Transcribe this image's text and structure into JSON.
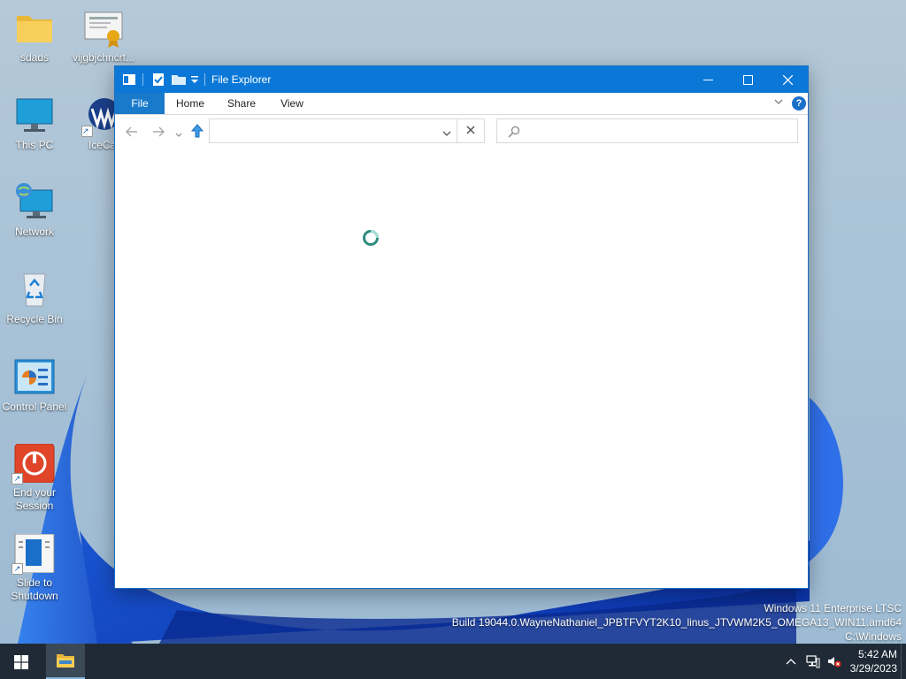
{
  "desktop": {
    "icons": [
      {
        "label": "sdads"
      },
      {
        "label": "vijgbjchncrt..."
      },
      {
        "label": "This PC"
      },
      {
        "label": "IceCa"
      },
      {
        "label": "Network"
      },
      {
        "label": "Recycle Bin"
      },
      {
        "label": "Control Panel"
      },
      {
        "label": "End your Session"
      },
      {
        "label": "Slide to Shutdown"
      }
    ],
    "watermark": {
      "line1": "Windows 11 Enterprise LTSC",
      "line2": "Build 19044.0.WayneNathaniel_JPBTFVYT2K10_linus_JTVWM2K5_OMEGA13_WIN11.amd64",
      "line3": "C:\\Windows"
    }
  },
  "window": {
    "title": "File Explorer",
    "ribbon": {
      "tabs": [
        {
          "label": "File"
        },
        {
          "label": "Home"
        },
        {
          "label": "Share"
        },
        {
          "label": "View"
        }
      ],
      "help": "?"
    },
    "address": {
      "value": "",
      "placeholder": ""
    },
    "search": {
      "value": "",
      "placeholder": ""
    }
  },
  "taskbar": {
    "clock": {
      "time": "5:42 AM",
      "date": "3/29/2023"
    }
  },
  "colors": {
    "titlebar": "#0b78d7",
    "file_tab": "#1979ca",
    "taskbar": "#1f2a36"
  },
  "icons": {
    "titlebar": [
      "explorer-window-icon",
      "properties-check-icon",
      "new-folder-icon",
      "customize-qa-dropdown-icon"
    ],
    "nav": [
      "back-arrow-icon",
      "forward-arrow-icon",
      "recent-locations-icon",
      "up-arrow-icon"
    ],
    "tray": [
      "chevron-up-icon",
      "network-icon",
      "volume-muted-icon"
    ]
  }
}
